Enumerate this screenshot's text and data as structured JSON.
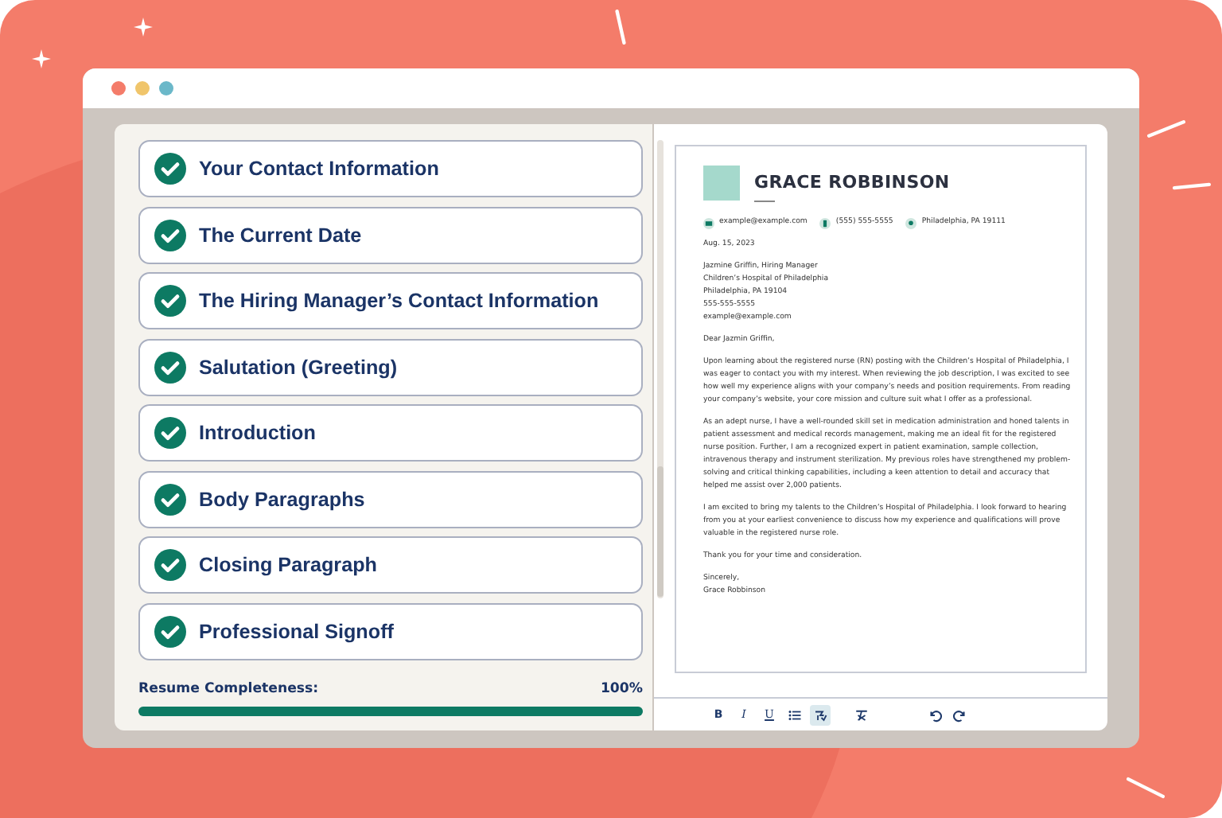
{
  "window": {
    "controls": [
      {
        "color": "#f47c6a"
      },
      {
        "color": "#f0c56b"
      },
      {
        "color": "#6bb8c9"
      }
    ]
  },
  "sections": [
    {
      "label": "Your Contact Information",
      "checked": true
    },
    {
      "label": "The Current Date",
      "checked": true
    },
    {
      "label": "The Hiring Manager’s Contact Information",
      "checked": true
    },
    {
      "label": "Salutation (Greeting)",
      "checked": true
    },
    {
      "label": "Introduction",
      "checked": true
    },
    {
      "label": "Body Paragraphs",
      "checked": true
    },
    {
      "label": "Closing Paragraph",
      "checked": true
    },
    {
      "label": "Professional Signoff",
      "checked": true
    }
  ],
  "completeness": {
    "label": "Resume Completeness:",
    "reading": "100%",
    "level": 1
  },
  "letter": {
    "name": "GRACE ROBBINSON",
    "contacts": [
      {
        "kind": "email",
        "text": "example@example.com"
      },
      {
        "kind": "phone",
        "text": "(555) 555-5555"
      },
      {
        "kind": "location",
        "text": "Philadelphia, PA 19111"
      }
    ],
    "date": "Aug. 15, 2023",
    "recipient": [
      "Jazmine Griffin, Hiring Manager",
      "Children’s Hospital of Philadelphia",
      "Philadelphia, PA 19104",
      "555-555-5555",
      "example@example.com"
    ],
    "salutation": "Dear Jazmin Griffin,",
    "paragraphs": [
      "Upon learning about the registered nurse (RN) posting with the Children’s Hospital of Philadelphia, I was eager to contact you with my interest. When reviewing the job description, I was excited to see how well my experience aligns with your company’s needs and position requirements. From reading your company’s website, your core mission and culture suit what I offer as a professional.",
      "As an adept nurse, I have a well-rounded skill set in medication administration and honed talents in patient assessment and medical records management, making me an ideal fit for the registered nurse position. Further, I am a recognized expert in patient examination, sample collection, intravenous therapy and instrument sterilization. My previous roles have strengthened my problem-solving and critical thinking capabilities, including a keen attention to detail and accuracy that helped me assist over 2,000 patients.",
      "I am excited to bring my talents to the Children’s Hospital of Philadelphia. I look forward to hearing from you at your earliest convenience to discuss how my experience and qualifications will prove valuable in the registered nurse role.",
      "Thank you for your time and consideration."
    ],
    "closing": "Sincerely,",
    "signature": "Grace Robbinson"
  },
  "toolbar": [
    {
      "kind": "bold",
      "label": "B",
      "active": false
    },
    {
      "kind": "italic",
      "label": "I",
      "active": false
    },
    {
      "kind": "underline",
      "label": "U",
      "active": false
    },
    {
      "kind": "list",
      "active": false
    },
    {
      "kind": "spellcheck",
      "active": true
    },
    {
      "kind": "clear",
      "active": false
    },
    {
      "kind": "undo",
      "active": false
    },
    {
      "kind": "redo",
      "active": false
    }
  ]
}
